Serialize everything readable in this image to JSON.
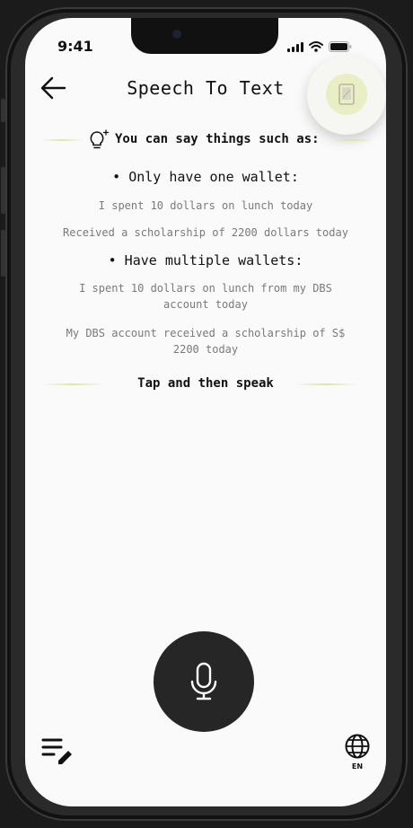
{
  "status_bar": {
    "time": "9:41"
  },
  "header": {
    "title": "Speech To Text"
  },
  "hint": {
    "intro": "You can say things such as:"
  },
  "sections": [
    {
      "heading": "• Only have one wallet:",
      "examples": [
        "I spent 10 dollars on lunch today",
        "Received a scholarship of 2200 dollars today"
      ]
    },
    {
      "heading": "• Have multiple wallets:",
      "examples": [
        "I spent 10 dollars on lunch from my DBS account today",
        "My DBS account received a scholarship of S$ 2200 today"
      ]
    }
  ],
  "instruction": "Tap and then speak",
  "language": {
    "code": "EN"
  },
  "icons": {
    "back": "arrow-left-icon",
    "device": "phone-device-icon",
    "hint": "lightbulb-icon",
    "mic": "microphone-icon",
    "notes": "edit-list-icon",
    "language": "globe-icon"
  },
  "colors": {
    "accent_glow": "#dce496",
    "mic_button": "#262626",
    "background": "#fafafa"
  }
}
